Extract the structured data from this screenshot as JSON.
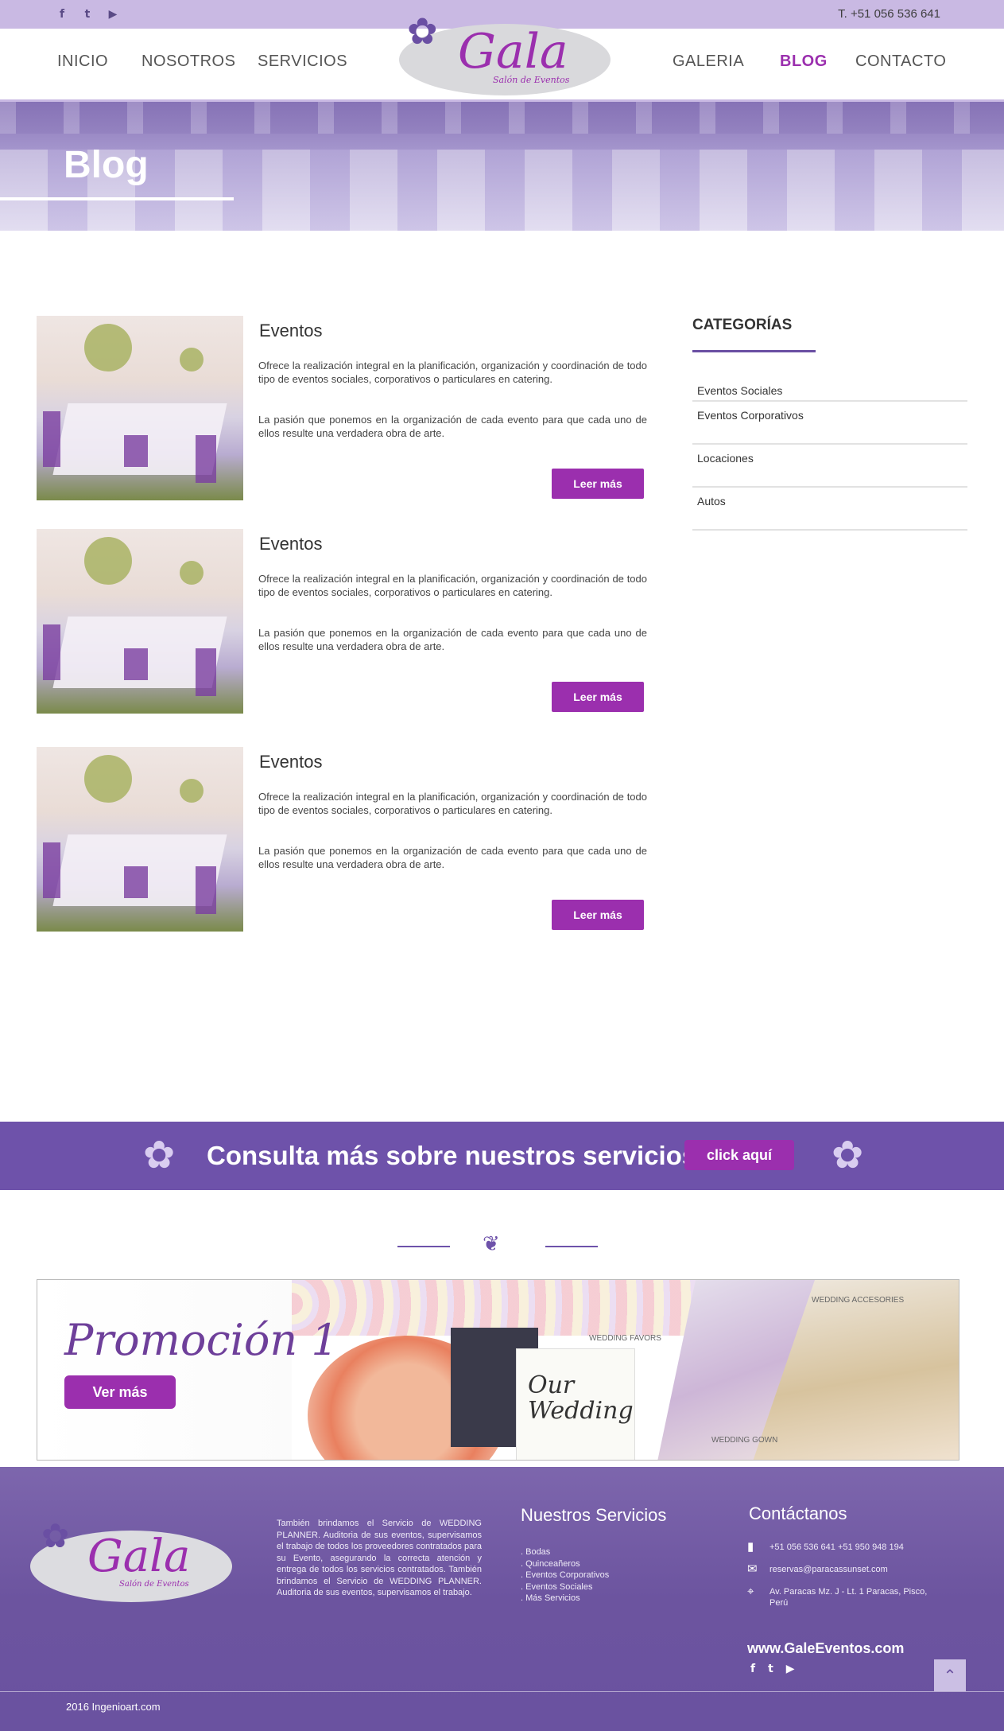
{
  "topbar": {
    "social": [
      {
        "icon": "facebook-icon",
        "glyph": "f"
      },
      {
        "icon": "twitter-icon",
        "glyph": "t"
      },
      {
        "icon": "youtube-icon",
        "glyph": "▶"
      }
    ],
    "phone": "T. +51 056 536 641"
  },
  "nav": {
    "items": [
      "INICIO",
      "NOSOTROS",
      "SERVICIOS",
      "GALERIA",
      "BLOG",
      "CONTACTO"
    ],
    "active": "BLOG"
  },
  "logo": {
    "word": "Gala",
    "sub": "Salón de Eventos"
  },
  "hero": {
    "title": "Blog"
  },
  "posts": [
    {
      "title": "Eventos",
      "p1": "Ofrece la realización integral en la planificación, organización y coordinación de todo tipo de eventos sociales, corporativos o particulares en catering.",
      "p2": "La pasión que ponemos en la organización de cada evento para que cada uno de ellos resulte una verdadera obra de arte.",
      "button": "Leer más"
    },
    {
      "title": "Eventos",
      "p1": "Ofrece la realización integral en la planificación, organización y coordinación de todo tipo de eventos sociales, corporativos o particulares en catering.",
      "p2": "La pasión que ponemos en la organización de cada evento para que cada uno de ellos resulte una verdadera obra de arte.",
      "button": "Leer más"
    },
    {
      "title": "Eventos",
      "p1": "Ofrece la realización integral en la planificación, organización y coordinación de todo tipo de eventos sociales, corporativos o particulares en catering.",
      "p2": "La pasión que ponemos en la organización de cada evento para que cada uno de ellos resulte una verdadera obra de arte.",
      "button": "Leer más"
    }
  ],
  "sidebar": {
    "title": "CATEGORÍAS",
    "items": [
      "Eventos Sociales",
      "Eventos Corporativos",
      "Locaciones",
      "Autos"
    ]
  },
  "cta": {
    "text": "Consulta más sobre nuestros servicios",
    "button": "click aquí"
  },
  "promo": {
    "title": "Promoción 1",
    "button": "Ver más",
    "labels": {
      "favors": "WEDDING FAVORS",
      "accessories": "WEDDING ACCESORIES",
      "gown": "WEDDING GOWN",
      "card": "Our Wedding"
    }
  },
  "footer": {
    "about": "También brindamos el Servicio de WEDDING PLANNER. Auditoria de sus eventos, supervisamos el trabajo de todos los proveedores contratados para su Evento, asegurando la correcta atención y entrega de todos los servicios contratados. También brindamos el Servicio de WEDDING PLANNER. Auditoria de sus eventos, supervisamos el trabajo.",
    "services_title": "Nuestros Servicios",
    "services": [
      ". Bodas",
      ". Quinceañeros",
      ". Eventos Corporativos",
      ". Eventos Sociales",
      ". Más Servicios"
    ],
    "contact_title": "Contáctanos",
    "phones": "+51 056 536 641 +51 950 948 194",
    "email": "reservas@paracassunset.com",
    "address": "Av. Paracas Mz. J - Lt. 1 Paracas, Pisco, Perú",
    "site": "www.GaleEventos.com",
    "copyright": "2016 Ingenioart.com"
  },
  "colors": {
    "accent": "#9b2fae",
    "brand": "#6e52aa",
    "topbar": "#c9b9e3"
  }
}
